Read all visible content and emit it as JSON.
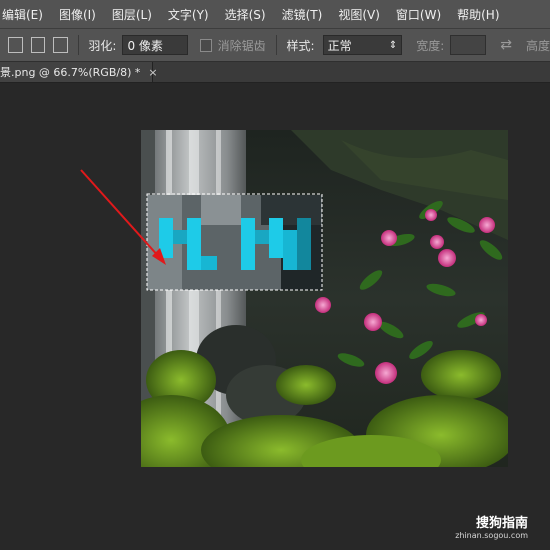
{
  "menu": {
    "items": [
      "编辑(E)",
      "图像(I)",
      "图层(L)",
      "文字(Y)",
      "选择(S)",
      "滤镜(T)",
      "视图(V)",
      "窗口(W)",
      "帮助(H)"
    ]
  },
  "options": {
    "feather_label": "羽化:",
    "feather_value": "0 像素",
    "anti_alias_label": "消除锯齿",
    "style_label": "样式:",
    "style_value": "正常",
    "width_label": "宽度:",
    "height_label": "高度"
  },
  "document": {
    "tab_label": "景.png @ 66.7%(RGB/8) *",
    "close_glyph": "×"
  },
  "watermark": {
    "main": "搜狗指南",
    "sub": "zhinan.sogou.com"
  },
  "colors": {
    "annotation_arrow": "#e0191b",
    "selection_marquee": "#ffffff",
    "pixelated_text": "#1ecbe8"
  },
  "icons": {
    "tool_preset_icon": "rect-select-icon",
    "new_selection_icon": "new-selection-icon",
    "add_selection_icon": "add-selection-icon",
    "subtract_selection_icon": "subtract-selection-icon",
    "swap_icon": "swap-arrows-icon"
  }
}
